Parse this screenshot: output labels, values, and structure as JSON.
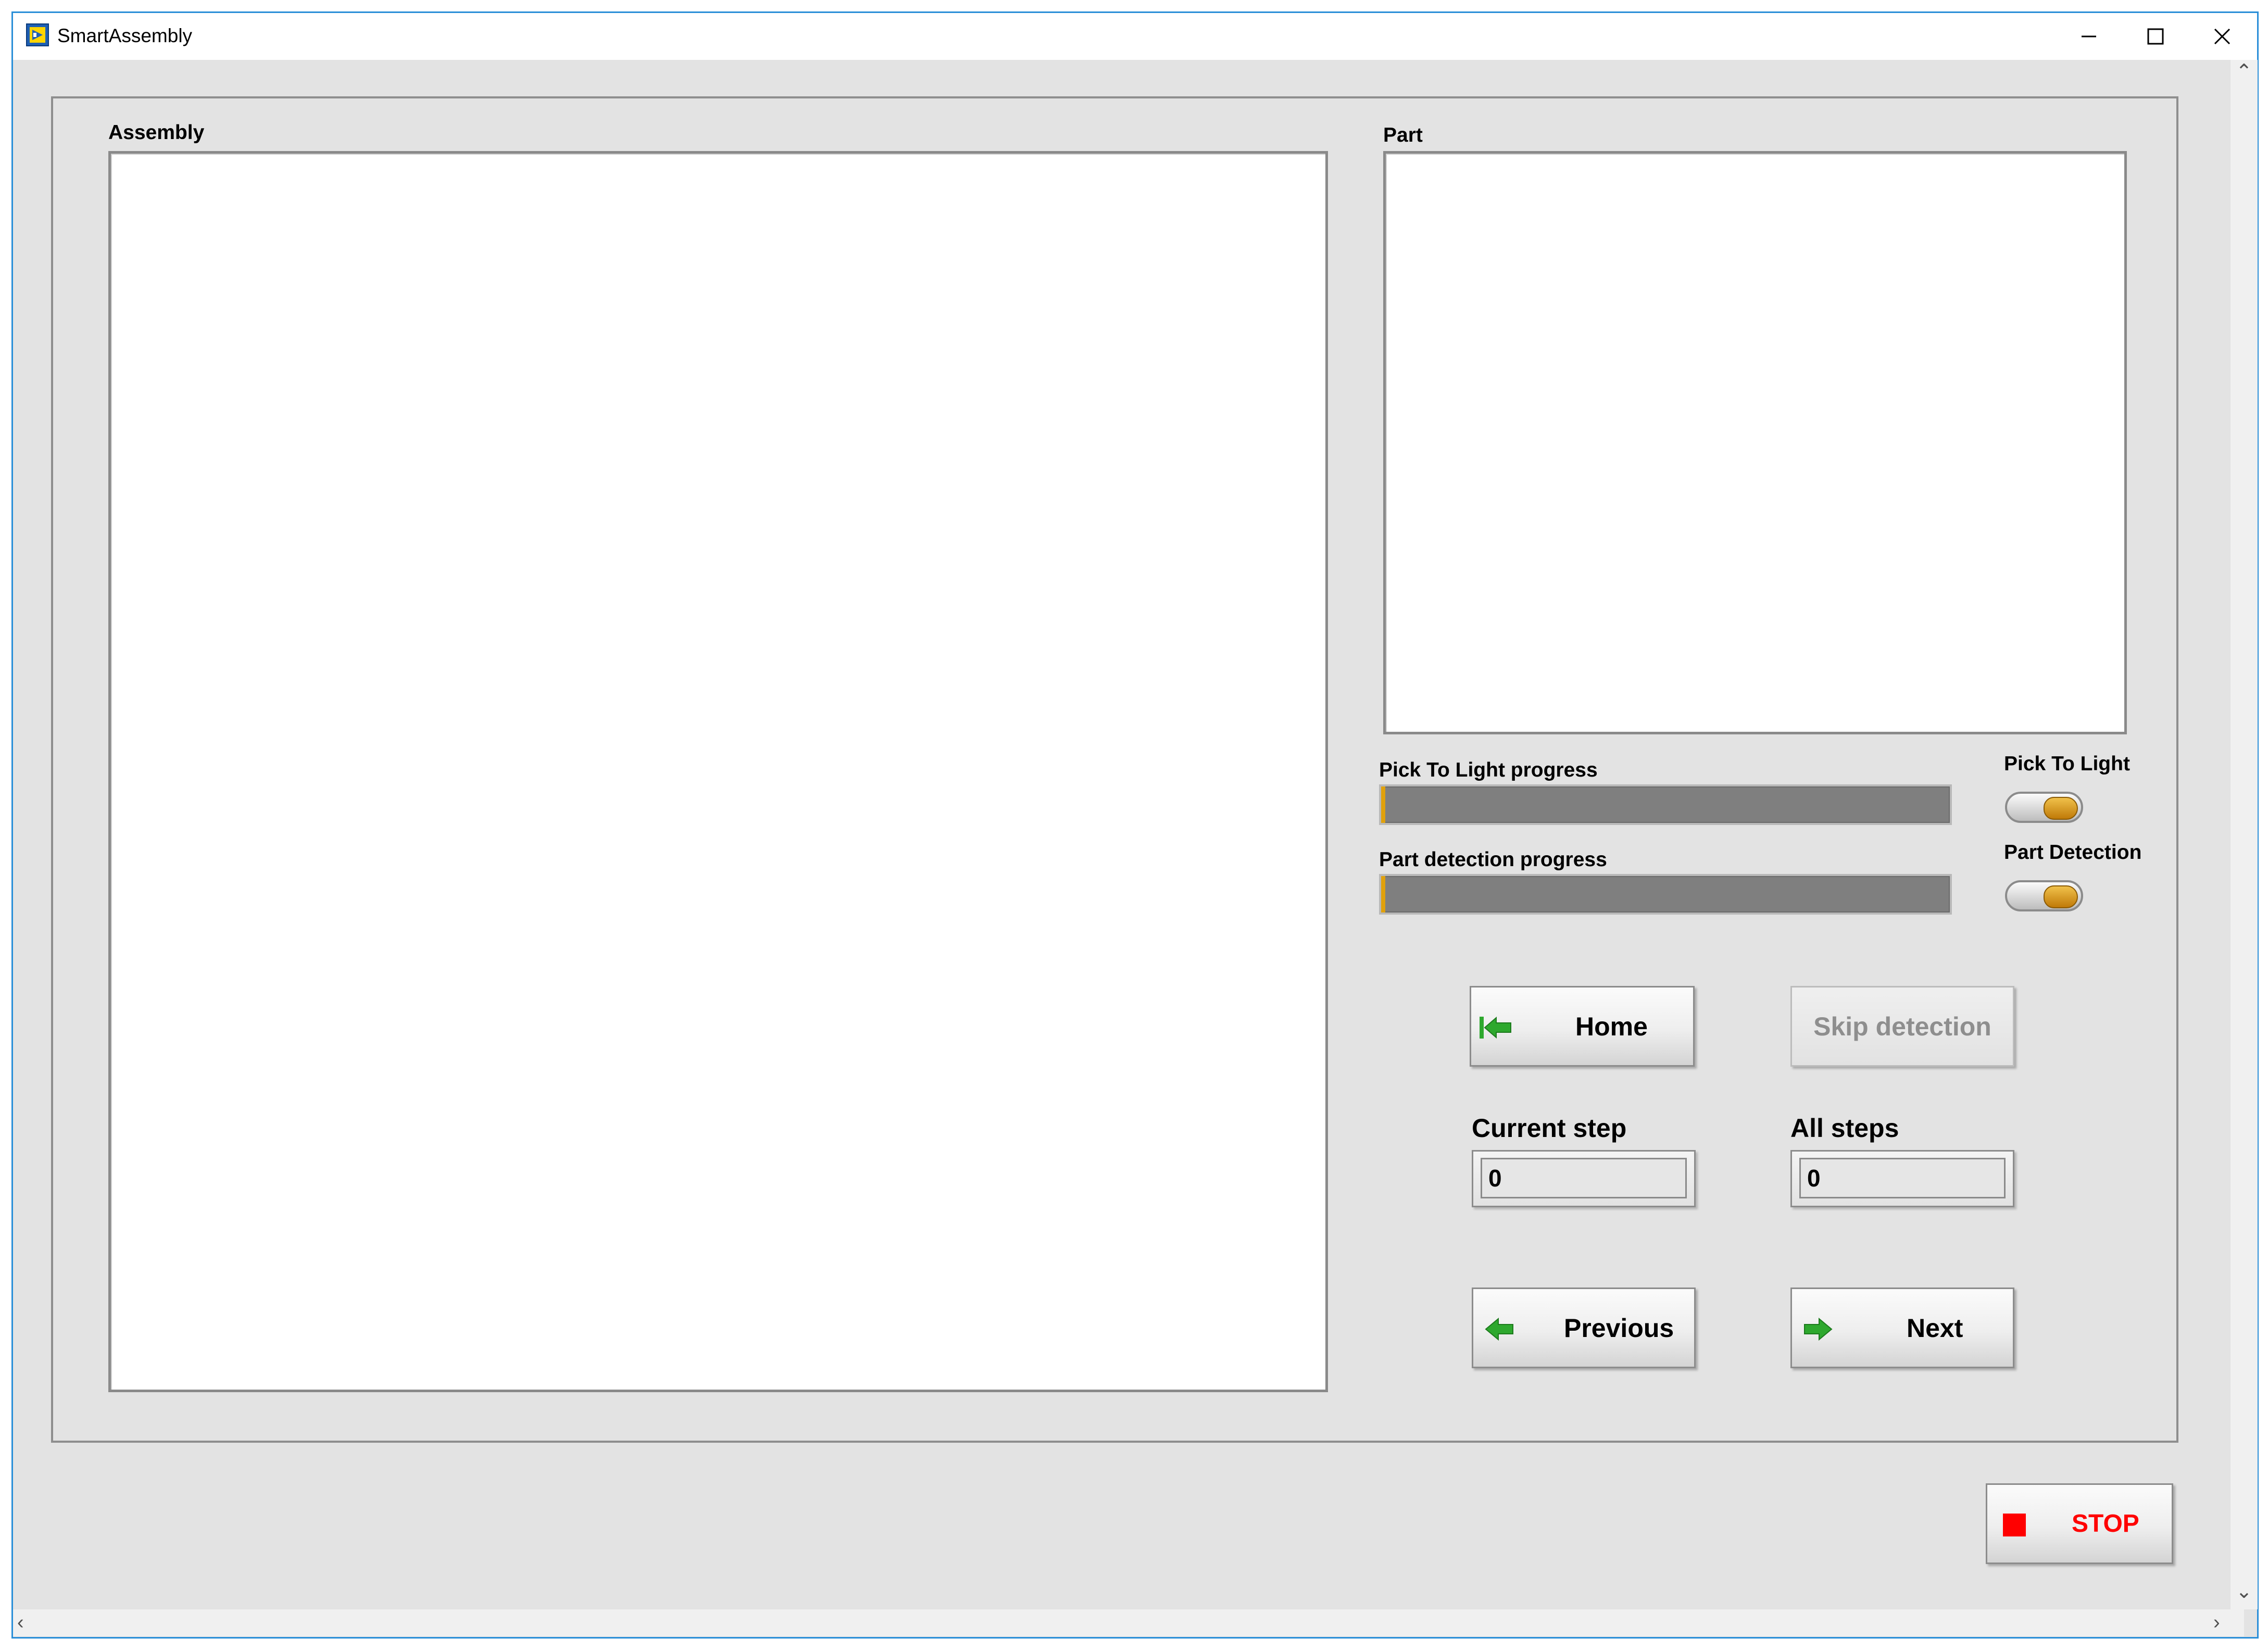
{
  "window": {
    "title": "SmartAssembly",
    "controls": [
      "minimize-icon",
      "maximize-icon",
      "close-icon"
    ]
  },
  "assembly": {
    "label": "Assembly"
  },
  "part": {
    "label": "Part"
  },
  "progress": {
    "pick_to_light": {
      "label": "Pick To Light progress",
      "value_fraction": 0.0
    },
    "part_detection": {
      "label": "Part detection progress",
      "value_fraction": 0.0
    }
  },
  "toggles": {
    "pick_to_light": {
      "label": "Pick To Light"
    },
    "part_detection": {
      "label": "Part Detection"
    }
  },
  "buttons": {
    "home": "Home",
    "skip_detection": "Skip detection",
    "previous": "Previous",
    "next": "Next",
    "stop": "STOP"
  },
  "steps": {
    "current_label": "Current step",
    "current_value": "0",
    "all_label": "All steps",
    "all_value": "0"
  },
  "colors": {
    "progress_fill": "#e0a10c",
    "stop_icon": "#ff0000",
    "arrow_icon": "#2ea82e",
    "window_border": "#2b8fd8"
  }
}
